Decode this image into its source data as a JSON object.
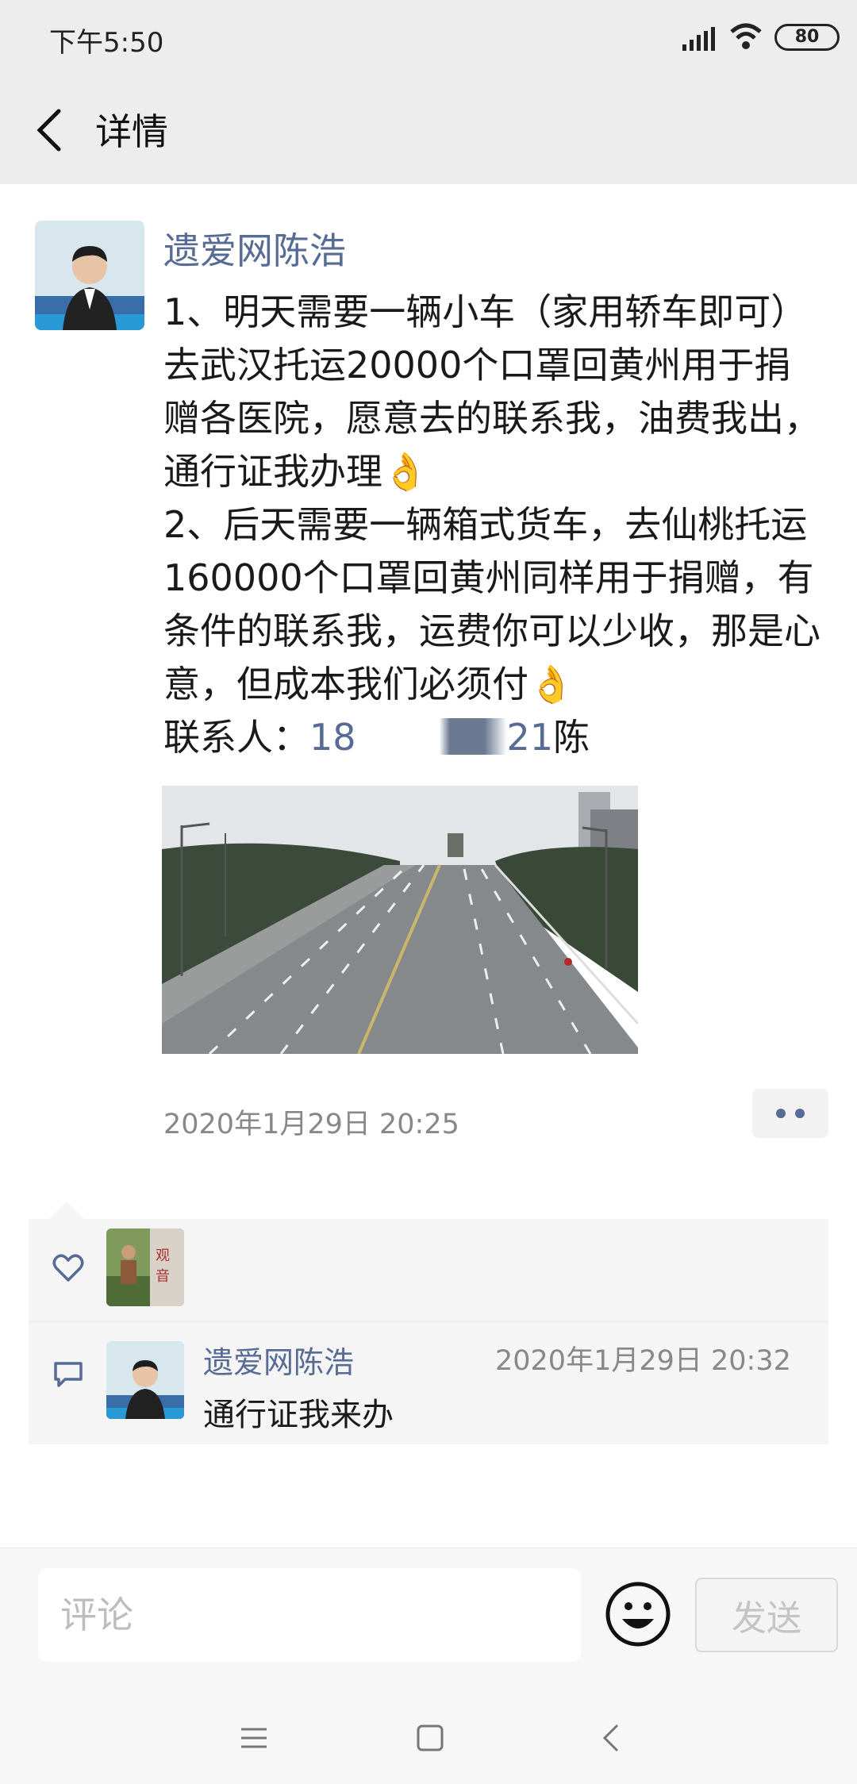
{
  "status_bar": {
    "time": "下午5:50",
    "battery": "80"
  },
  "header": {
    "title": "详情"
  },
  "post": {
    "author": "遗爱网陈浩",
    "text": "1、明天需要一辆小车（家用轿车即可）去武汉托运20000个口罩回黄州用于捐赠各医院，愿意去的联系我，油费我出，通行证我办理👌\n2、后天需要一辆箱式货车，去仙桃托运160000个口罩回黄州同样用于捐赠，有条件的联系我，运费你可以少收，那是心意，但成本我们必须付👌",
    "contact_label": "联系人：",
    "contact_phone_start": "18",
    "contact_phone_end": "21",
    "contact_name": "陈",
    "timestamp": "2020年1月29日 20:25"
  },
  "comments": [
    {
      "author": "遗爱网陈浩",
      "time": "2020年1月29日 20:32",
      "text": "通行证我来办"
    }
  ],
  "input_bar": {
    "placeholder": "评论",
    "send_label": "发送"
  },
  "colors": {
    "link": "#576b95",
    "background": "#ededed",
    "panel": "#f5f5f5"
  }
}
